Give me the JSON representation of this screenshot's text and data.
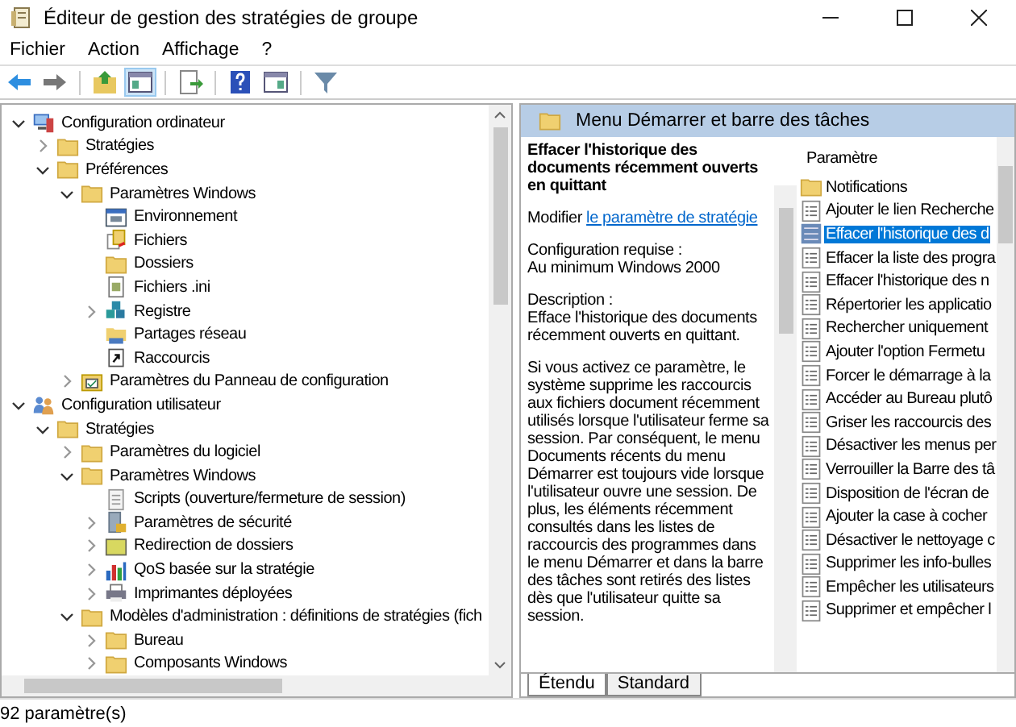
{
  "window": {
    "title": "Éditeur de gestion des stratégies de groupe"
  },
  "menu": [
    "Fichier",
    "Action",
    "Affichage",
    "?"
  ],
  "toolbar": [
    {
      "kind": "back"
    },
    {
      "kind": "forward"
    },
    {
      "kind": "sep"
    },
    {
      "kind": "up"
    },
    {
      "kind": "tree",
      "selected": true
    },
    {
      "kind": "sep"
    },
    {
      "kind": "export"
    },
    {
      "kind": "sep"
    },
    {
      "kind": "help"
    },
    {
      "kind": "pane"
    },
    {
      "kind": "sep"
    },
    {
      "kind": "filter"
    }
  ],
  "tree": [
    {
      "label": "Configuration ordinateur",
      "kind": "computer",
      "expanded": true,
      "children": [
        {
          "label": "Stratégies",
          "kind": "folder",
          "expanded": false
        },
        {
          "label": "Préférences",
          "kind": "folder",
          "expanded": true,
          "children": [
            {
              "label": "Paramètres Windows",
              "kind": "folder",
              "expanded": true,
              "children": [
                {
                  "label": "Environnement",
                  "kind": "env"
                },
                {
                  "label": "Fichiers",
                  "kind": "files"
                },
                {
                  "label": "Dossiers",
                  "kind": "folder"
                },
                {
                  "label": "Fichiers .ini",
                  "kind": "ini"
                },
                {
                  "label": "Registre",
                  "kind": "registry",
                  "expanded": false
                },
                {
                  "label": "Partages réseau",
                  "kind": "share"
                },
                {
                  "label": "Raccourcis",
                  "kind": "shortcut"
                }
              ]
            },
            {
              "label": "Paramètres du Panneau de configuration",
              "kind": "control",
              "expanded": false
            }
          ]
        }
      ]
    },
    {
      "label": "Configuration utilisateur",
      "kind": "users",
      "expanded": true,
      "children": [
        {
          "label": "Stratégies",
          "kind": "folder",
          "expanded": true,
          "children": [
            {
              "label": "Paramètres du logiciel",
              "kind": "folder",
              "expanded": false
            },
            {
              "label": "Paramètres Windows",
              "kind": "folder",
              "expanded": true,
              "children": [
                {
                  "label": "Scripts (ouverture/fermeture de session)",
                  "kind": "script"
                },
                {
                  "label": "Paramètres de sécurité",
                  "kind": "security",
                  "expanded": false
                },
                {
                  "label": "Redirection de dossiers",
                  "kind": "redirect",
                  "expanded": false
                },
                {
                  "label": "QoS basée sur la stratégie",
                  "kind": "chart",
                  "expanded": false
                },
                {
                  "label": "Imprimantes déployées",
                  "kind": "printer",
                  "expanded": false
                }
              ]
            },
            {
              "label": "Modèles d'administration : définitions de stratégies (fich",
              "kind": "folder",
              "expanded": true,
              "children": [
                {
                  "label": "Bureau",
                  "kind": "folder",
                  "expanded": false
                },
                {
                  "label": "Composants Windows",
                  "kind": "folder",
                  "expanded": false
                }
              ]
            }
          ]
        }
      ]
    }
  ],
  "details": {
    "header": "Menu Démarrer et barre des tâches",
    "title": "Effacer l'historique des documents récemment ouverts en quittant",
    "edit_prefix": "Modifier",
    "edit_link": "le paramètre de stratégie",
    "requirements_label": "Configuration requise :",
    "requirements_value": "Au minimum Windows 2000",
    "description_label": "Description :",
    "description": "Efface l'historique des documents récemment ouverts en quittant.",
    "body": "Si vous activez ce paramètre, le système supprime les raccourcis aux fichiers document récemment utilisés lorsque l'utilisateur ferme sa session. Par conséquent, le menu Documents récents du menu Démarrer est toujours vide lorsque l'utilisateur ouvre une session. De plus, les éléments récemment consultés dans les listes de raccourcis des programmes dans le menu Démarrer et dans la barre des tâches sont retirés des listes dès que l'utilisateur quitte sa session."
  },
  "list": {
    "column": "Paramètre",
    "items": [
      {
        "label": "Notifications",
        "kind": "folder",
        "selected": false
      },
      {
        "label": "Ajouter le lien Recherche",
        "kind": "setting",
        "selected": false
      },
      {
        "label": "Effacer l'historique des d",
        "kind": "setting",
        "selected": true
      },
      {
        "label": "Effacer la liste des progra",
        "kind": "setting",
        "selected": false
      },
      {
        "label": "Effacer l'historique des n",
        "kind": "setting",
        "selected": false
      },
      {
        "label": "Répertorier les applicatio",
        "kind": "setting",
        "selected": false
      },
      {
        "label": "Rechercher uniquement",
        "kind": "setting",
        "selected": false
      },
      {
        "label": "Ajouter l'option Fermetu",
        "kind": "setting",
        "selected": false
      },
      {
        "label": "Forcer le démarrage à la",
        "kind": "setting",
        "selected": false
      },
      {
        "label": "Accéder au Bureau plutô",
        "kind": "setting",
        "selected": false
      },
      {
        "label": "Griser les raccourcis des",
        "kind": "setting",
        "selected": false
      },
      {
        "label": "Désactiver les menus per",
        "kind": "setting",
        "selected": false
      },
      {
        "label": "Verrouiller la Barre des tâ",
        "kind": "setting",
        "selected": false
      },
      {
        "label": "Disposition de l'écran de",
        "kind": "setting",
        "selected": false
      },
      {
        "label": "Ajouter la case à cocher",
        "kind": "setting",
        "selected": false
      },
      {
        "label": "Désactiver le nettoyage c",
        "kind": "setting",
        "selected": false
      },
      {
        "label": "Supprimer les info-bulles",
        "kind": "setting",
        "selected": false
      },
      {
        "label": "Empêcher les utilisateurs",
        "kind": "setting",
        "selected": false
      },
      {
        "label": "Supprimer et empêcher l",
        "kind": "setting",
        "selected": false
      }
    ]
  },
  "tabs": [
    {
      "label": "Étendu",
      "selected": true
    },
    {
      "label": "Standard",
      "selected": false
    }
  ],
  "status_bar": "92 paramètre(s)"
}
